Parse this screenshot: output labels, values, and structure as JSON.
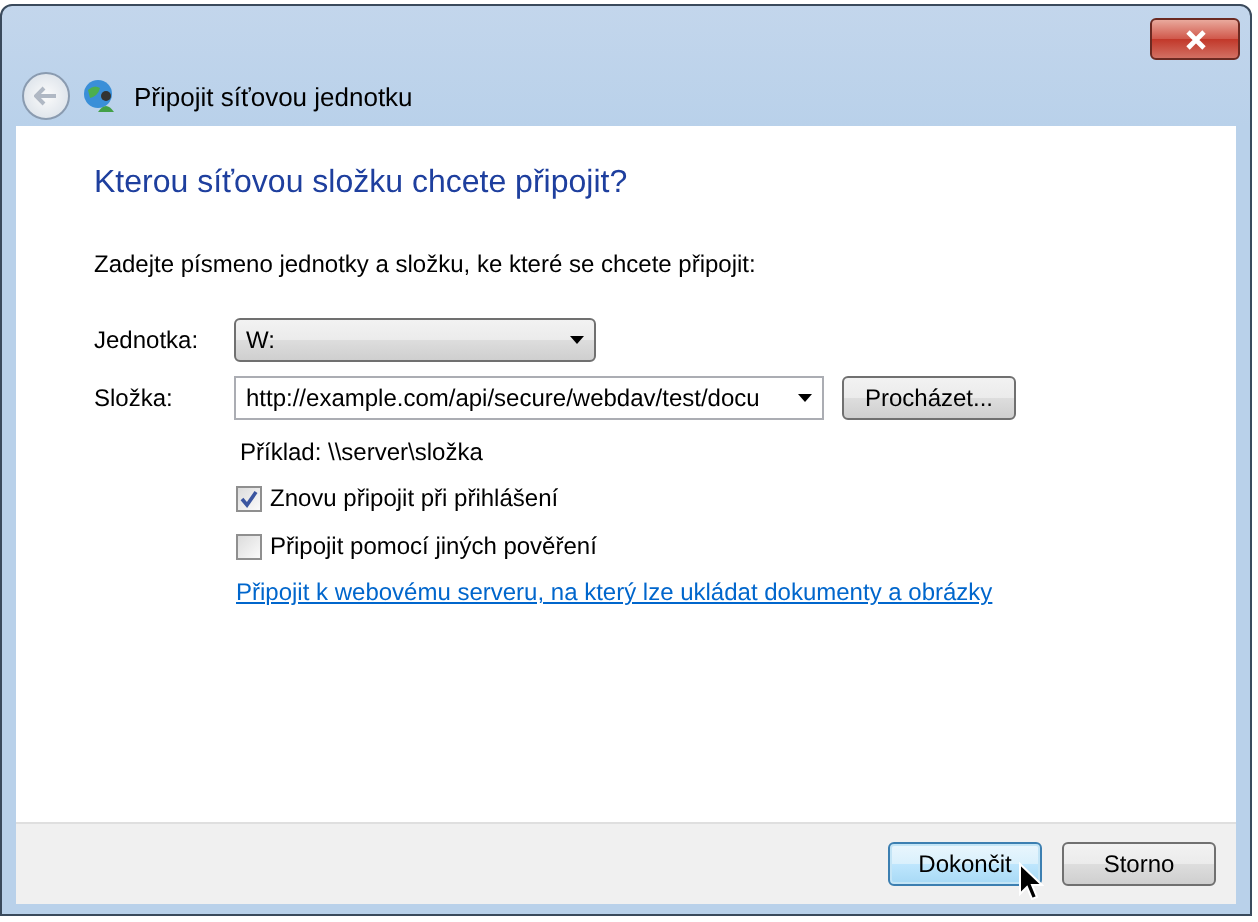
{
  "window": {
    "title": "Připojit síťovou jednotku"
  },
  "heading": "Kterou síťovou složku chcete připojit?",
  "instruction": "Zadejte písmeno jednotky a složku, ke které se chcete připojit:",
  "fields": [
    {
      "label": "Jednotka:",
      "kind": "dropdown",
      "value": "W:"
    },
    {
      "label": "Složka:",
      "kind": "combo",
      "value": "http://example.com/api/secure/webdav/test/docu"
    }
  ],
  "browse_button": "Procházet...",
  "example": "Příklad: \\\\server\\složka",
  "checkboxes": [
    {
      "label": "Znovu připojit při přihlášení",
      "checked": true
    },
    {
      "label": "Připojit pomocí jiných pověření",
      "checked": false
    }
  ],
  "link": "Připojit k webovému serveru, na který lze ukládat dokumenty a obrázky",
  "buttons": [
    {
      "label": "Dokončit",
      "default": true
    },
    {
      "label": "Storno",
      "default": false
    }
  ]
}
